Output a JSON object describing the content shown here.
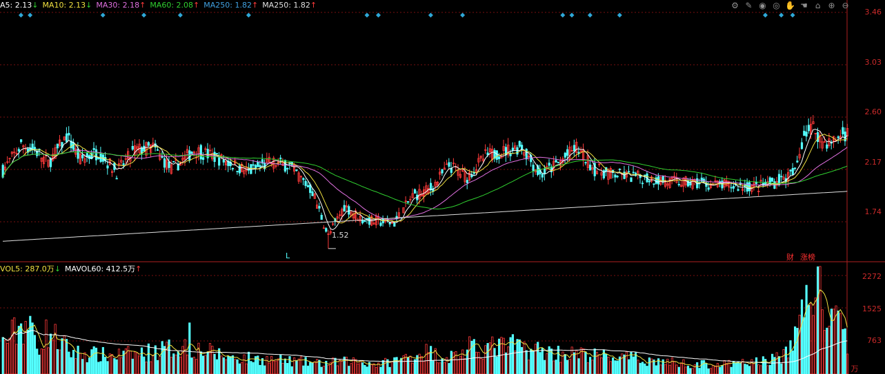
{
  "price_legend": [
    {
      "label": "A5: 2.13",
      "arrow": "↓",
      "color": "#ffffff"
    },
    {
      "label": "MA10: 2.13",
      "arrow": "↓",
      "color": "#f0e040"
    },
    {
      "label": "MA30: 2.18",
      "arrow": "↑",
      "color": "#e070e0"
    },
    {
      "label": "MA60: 2.08",
      "arrow": "↑",
      "color": "#30d030"
    },
    {
      "label": "MA250: 1.82",
      "arrow": "↑",
      "color": "#40a0e0"
    },
    {
      "label": "MA250: 1.82",
      "arrow": "↑",
      "color": "#e0e0e0"
    }
  ],
  "volume_legend": [
    {
      "label": "VOL5: 287.0万",
      "arrow": "↓",
      "color": "#f0e040"
    },
    {
      "label": "MAVOL60: 412.5万",
      "arrow": "↑",
      "color": "#ffffff"
    }
  ],
  "toolbar": [
    {
      "name": "settings-icon",
      "glyph": "⚙"
    },
    {
      "name": "pen-icon",
      "glyph": "✎"
    },
    {
      "name": "eye-icon",
      "glyph": "◉"
    },
    {
      "name": "eye-alt-icon",
      "glyph": "◎"
    },
    {
      "name": "hand-icon",
      "glyph": "✋"
    },
    {
      "name": "hand-alt-icon",
      "glyph": "☚"
    },
    {
      "name": "lock-icon",
      "glyph": "⌂"
    },
    {
      "name": "zoom-in-icon",
      "glyph": "⊕"
    },
    {
      "name": "zoom-out-icon",
      "glyph": "⊖"
    }
  ],
  "price_axis_ticks": [
    "3.46",
    "3.03",
    "2.60",
    "2.17",
    "1.74"
  ],
  "volume_axis_ticks": [
    "2272",
    "1525",
    "763"
  ],
  "volume_unit": "万",
  "low_marker": {
    "label": "1.52",
    "value": 1.52
  },
  "l_marker": "L",
  "tag_cai": "财",
  "tag_zhangbang": "涨榜",
  "colors": {
    "up": "#ff3a3a",
    "down": "#54ffff",
    "grid": "#7a1010",
    "axis": "#b02020",
    "marker": "#2fa8d8"
  },
  "chart_data": {
    "type": "candlestick",
    "price_range": [
      1.44,
      3.46
    ],
    "volume_range": [
      0,
      2272
    ],
    "grid": true,
    "price_ticks": [
      3.46,
      3.03,
      2.6,
      2.17,
      1.74
    ],
    "volume_ticks": [
      2272,
      1525,
      763
    ],
    "anchors": [
      [
        0,
        2.16
      ],
      [
        8,
        2.37
      ],
      [
        14,
        2.33
      ],
      [
        20,
        2.22
      ],
      [
        28,
        2.44
      ],
      [
        34,
        2.25
      ],
      [
        42,
        2.31
      ],
      [
        50,
        2.15
      ],
      [
        58,
        2.33
      ],
      [
        66,
        2.35
      ],
      [
        74,
        2.17
      ],
      [
        84,
        2.33
      ],
      [
        92,
        2.28
      ],
      [
        100,
        2.22
      ],
      [
        108,
        2.15
      ],
      [
        118,
        2.23
      ],
      [
        126,
        2.2
      ],
      [
        136,
        1.99
      ],
      [
        143,
        1.62
      ],
      [
        150,
        1.87
      ],
      [
        158,
        1.76
      ],
      [
        166,
        1.74
      ],
      [
        172,
        1.73
      ],
      [
        180,
        1.95
      ],
      [
        188,
        2.01
      ],
      [
        196,
        2.2
      ],
      [
        204,
        2.11
      ],
      [
        212,
        2.28
      ],
      [
        220,
        2.32
      ],
      [
        228,
        2.36
      ],
      [
        236,
        2.12
      ],
      [
        244,
        2.22
      ],
      [
        252,
        2.35
      ],
      [
        260,
        2.17
      ],
      [
        268,
        2.13
      ],
      [
        276,
        2.11
      ],
      [
        284,
        2.1
      ],
      [
        292,
        2.07
      ],
      [
        300,
        2.06
      ],
      [
        308,
        2.05
      ],
      [
        316,
        2.04
      ],
      [
        324,
        2.03
      ],
      [
        332,
        2.03
      ],
      [
        340,
        2.07
      ],
      [
        348,
        2.14
      ],
      [
        352,
        2.47
      ],
      [
        356,
        2.52
      ],
      [
        360,
        2.4
      ],
      [
        364,
        2.39
      ],
      [
        368,
        2.45
      ],
      [
        371,
        2.47
      ]
    ],
    "volume_anchors": [
      [
        0,
        700
      ],
      [
        10,
        1200
      ],
      [
        15,
        640
      ],
      [
        20,
        980
      ],
      [
        30,
        500
      ],
      [
        45,
        420
      ],
      [
        60,
        460
      ],
      [
        80,
        640
      ],
      [
        100,
        380
      ],
      [
        120,
        320
      ],
      [
        140,
        240
      ],
      [
        155,
        300
      ],
      [
        165,
        220
      ],
      [
        175,
        340
      ],
      [
        185,
        520
      ],
      [
        195,
        380
      ],
      [
        210,
        600
      ],
      [
        225,
        640
      ],
      [
        240,
        500
      ],
      [
        260,
        420
      ],
      [
        275,
        360
      ],
      [
        290,
        280
      ],
      [
        305,
        220
      ],
      [
        320,
        220
      ],
      [
        335,
        300
      ],
      [
        345,
        450
      ],
      [
        350,
        1300
      ],
      [
        355,
        1900
      ],
      [
        357,
        2272
      ],
      [
        360,
        1500
      ],
      [
        365,
        1200
      ],
      [
        371,
        800
      ]
    ],
    "volume_spikes": [
      [
        13,
        1180
      ],
      [
        82,
        1180
      ],
      [
        205,
        860
      ]
    ],
    "signal_positions_top": [
      [
        8,
        12
      ],
      [
        44,
        62
      ],
      [
        78,
        108
      ],
      [
        160,
        165,
        188,
        202
      ],
      [
        246,
        250,
        258,
        271
      ],
      [
        335,
        342,
        347
      ]
    ],
    "n_bars": 372
  }
}
